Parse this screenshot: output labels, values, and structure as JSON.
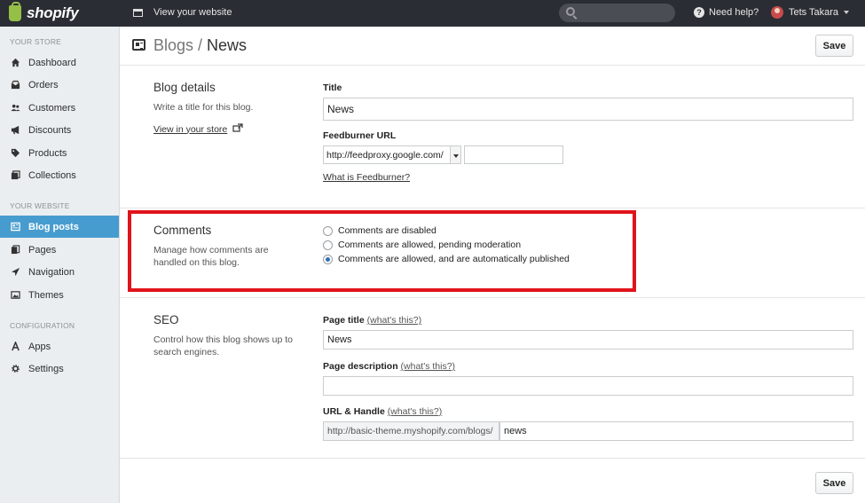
{
  "topbar": {
    "logo": "shopify",
    "view_website": "View your website",
    "help": "Need help?",
    "user_name": "Tets Takara"
  },
  "sidebar": {
    "sections": [
      "YOUR STORE",
      "YOUR WEBSITE",
      "CONFIGURATION"
    ],
    "items": [
      {
        "label": "Dashboard",
        "icon": "home-icon"
      },
      {
        "label": "Orders",
        "icon": "inbox-icon"
      },
      {
        "label": "Customers",
        "icon": "users-icon"
      },
      {
        "label": "Discounts",
        "icon": "megaphone-icon"
      },
      {
        "label": "Products",
        "icon": "tag-icon"
      },
      {
        "label": "Collections",
        "icon": "collections-icon"
      },
      {
        "label": "Blog posts",
        "icon": "blog-icon",
        "active": true
      },
      {
        "label": "Pages",
        "icon": "pages-icon"
      },
      {
        "label": "Navigation",
        "icon": "compass-icon"
      },
      {
        "label": "Themes",
        "icon": "image-icon"
      },
      {
        "label": "Apps",
        "icon": "apps-icon"
      },
      {
        "label": "Settings",
        "icon": "gear-icon"
      }
    ]
  },
  "header": {
    "crumb": "Blogs /",
    "title": "News",
    "save": "Save"
  },
  "blog_details": {
    "title": "Blog details",
    "desc": "Write a title for this blog.",
    "view_link": "View in your store",
    "title_label": "Title",
    "title_value": "News",
    "feedburner_label": "Feedburner URL",
    "feedburner_select": "http://feedproxy.google.com/",
    "feedburner_value": "",
    "feedburner_help": "What is Feedburner?"
  },
  "comments": {
    "title": "Comments",
    "desc": "Manage how comments are handled on this blog.",
    "options": [
      {
        "label": "Comments are disabled",
        "checked": false
      },
      {
        "label": "Comments are allowed, pending moderation",
        "checked": false
      },
      {
        "label": "Comments are allowed, and are automatically published",
        "checked": true
      }
    ]
  },
  "seo": {
    "title": "SEO",
    "desc": "Control how this blog shows up to search engines.",
    "page_title_label": "Page title",
    "page_title_hint": "(what's this?)",
    "page_title_value": "News",
    "page_desc_label": "Page description",
    "page_desc_hint": "(what's this?)",
    "page_desc_value": "",
    "handle_label": "URL & Handle",
    "handle_hint": "(what's this?)",
    "handle_prefix": "http://basic-theme.myshopify.com/blogs/",
    "handle_value": "news"
  },
  "footer": {
    "save": "Save"
  },
  "colors": {
    "topbar": "#2a2d33",
    "sidebar": "#ebeef0",
    "active": "#479ccf",
    "highlight": "#e1131b",
    "logo": "#95bf47"
  }
}
